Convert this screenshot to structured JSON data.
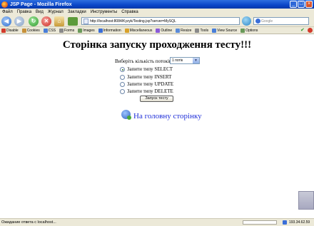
{
  "window": {
    "title": "JSP Page - Mozilla Firefox"
  },
  "menu": [
    "Файл",
    "Правка",
    "Вид",
    "Журнал",
    "Закладки",
    "Инструменты",
    "Справка"
  ],
  "address": {
    "url": "http://localhost:8084/Kyzyk/Testing.jsp?server=MySQL"
  },
  "search": {
    "placeholder": "Google"
  },
  "devtoolbar": {
    "items": [
      {
        "label": "Disable",
        "color": "#d23b2c"
      },
      {
        "label": "Cookies",
        "color": "#c7913a"
      },
      {
        "label": "CSS",
        "color": "#4a7ed8"
      },
      {
        "label": "Forms",
        "color": "#8a8a8a"
      },
      {
        "label": "Images",
        "color": "#6a9a5a"
      },
      {
        "label": "Information",
        "color": "#3a6ed8"
      },
      {
        "label": "Miscellaneous",
        "color": "#d8a12a"
      },
      {
        "label": "Outline",
        "color": "#8a5ad8"
      },
      {
        "label": "Resize",
        "color": "#5a8ad8"
      },
      {
        "label": "Tools",
        "color": "#8a8a8a"
      },
      {
        "label": "View Source",
        "color": "#4a7ed8"
      },
      {
        "label": "Options",
        "color": "#6a9a5a"
      }
    ]
  },
  "page": {
    "title": "Сторінка запуску проходження тесту!!!",
    "threads_label": "Виберіть кількість потоків:",
    "threads_value": "1 потік",
    "radios": [
      {
        "label": "Запити типу SELECT",
        "checked": true
      },
      {
        "label": "Запити типу INSERT",
        "checked": false
      },
      {
        "label": "Запити типу UPDATE",
        "checked": false
      },
      {
        "label": "Запити типу DELETE",
        "checked": false
      }
    ],
    "start_button": "Запуск тесту",
    "home_link": "На головну сторінку"
  },
  "status": {
    "text": "Ожидание ответа с localhost...",
    "ip": "193.34.62.59"
  }
}
